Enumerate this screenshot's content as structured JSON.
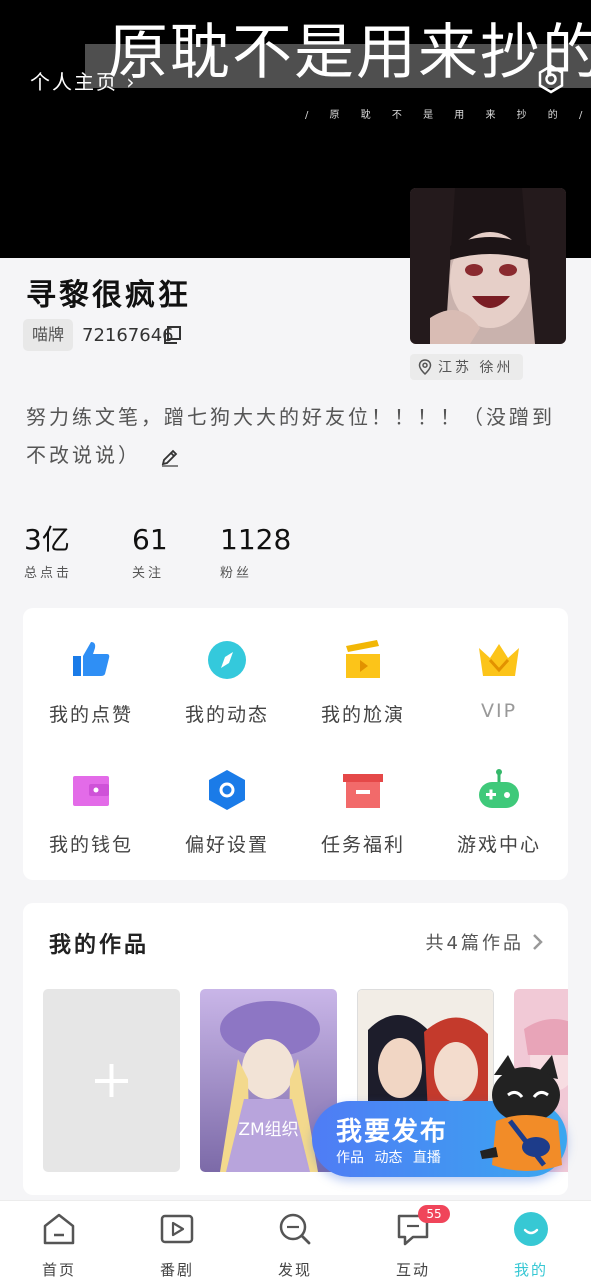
{
  "header": {
    "back_label": "个人主页",
    "banner_title": "原耽不是用来抄的",
    "banner_subtitle": "/ 原 耽 不 是 用 来 抄 的 /"
  },
  "profile": {
    "name": "寻黎很疯狂",
    "badge": "喵牌",
    "user_id": "72167646",
    "location": "江苏 徐州",
    "bio": "努力练文笔，蹭七狗大大的好友位！！！！（没蹭到不改说说）"
  },
  "stats": [
    {
      "value": "3亿",
      "label": "总点击"
    },
    {
      "value": "61",
      "label": "关注"
    },
    {
      "value": "1128",
      "label": "粉丝"
    }
  ],
  "menu": [
    {
      "label": "我的点赞",
      "icon": "thumbs-up-icon"
    },
    {
      "label": "我的动态",
      "icon": "compass-icon"
    },
    {
      "label": "我的尬演",
      "icon": "clapperboard-icon"
    },
    {
      "label": "VIP",
      "icon": "crown-icon"
    },
    {
      "label": "我的钱包",
      "icon": "wallet-icon"
    },
    {
      "label": "偏好设置",
      "icon": "hexagon-settings-icon"
    },
    {
      "label": "任务福利",
      "icon": "gift-box-icon"
    },
    {
      "label": "游戏中心",
      "icon": "gamepad-icon"
    }
  ],
  "works": {
    "title": "我的作品",
    "count_label": "共4篇作品",
    "items": [
      {
        "caption": ""
      },
      {
        "caption": "ZM组织"
      },
      {
        "caption": ""
      },
      {
        "caption": ""
      }
    ]
  },
  "publish": {
    "title": "我要发布",
    "options": "作品 动态 直播"
  },
  "tabs": [
    {
      "label": "首页",
      "icon": "home-icon"
    },
    {
      "label": "番剧",
      "icon": "play-icon"
    },
    {
      "label": "发现",
      "icon": "discover-icon"
    },
    {
      "label": "互动",
      "icon": "chat-icon",
      "badge": "55"
    },
    {
      "label": "我的",
      "icon": "profile-icon",
      "active": true
    }
  ],
  "colors": {
    "accent": "#37c8d4",
    "notification": "#f0455a",
    "publish_button": "#3a8cf0"
  }
}
